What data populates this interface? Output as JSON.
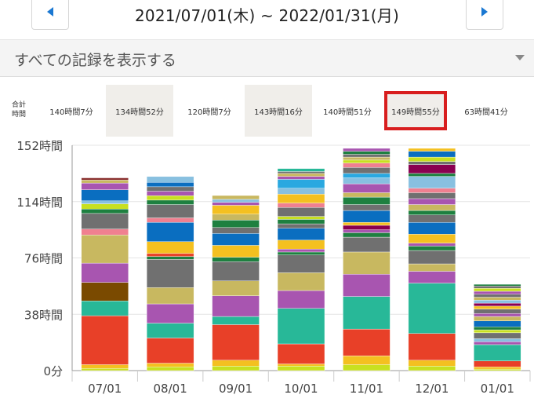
{
  "header": {
    "date_range": "2021/07/01(木) ~ 2022/01/31(月)"
  },
  "filter": {
    "label": "すべての記録を表示する"
  },
  "summary": {
    "label_line1": "合計",
    "label_line2": "時間",
    "months": [
      {
        "total": "140時間7分",
        "shaded": false,
        "selected": false
      },
      {
        "total": "134時間52分",
        "shaded": true,
        "selected": false
      },
      {
        "total": "120時間7分",
        "shaded": false,
        "selected": false
      },
      {
        "total": "143時間16分",
        "shaded": true,
        "selected": false
      },
      {
        "total": "140時間51分",
        "shaded": false,
        "selected": false
      },
      {
        "total": "149時間55分",
        "shaded": true,
        "selected": true
      },
      {
        "total": "63時間41分",
        "shaded": false,
        "selected": false
      }
    ]
  },
  "chart_data": {
    "type": "bar",
    "stacked": true,
    "categories": [
      "07/01",
      "08/01",
      "09/01",
      "10/01",
      "11/01",
      "12/01",
      "01/01"
    ],
    "y_ticks": [
      "0分",
      "38時間",
      "76時間",
      "114時間",
      "152時間"
    ],
    "y_tick_values": [
      0,
      38,
      76,
      114,
      152
    ],
    "ylim": [
      0,
      152
    ],
    "totals_hours": [
      140.1,
      134.9,
      120.1,
      143.3,
      140.9,
      149.9,
      63.7
    ],
    "stacks": [
      [
        [
          1.5,
          "#c8e020"
        ],
        [
          2.5,
          "#f4c020"
        ],
        [
          33,
          "#e84028"
        ],
        [
          10,
          "#28b898"
        ],
        [
          12.5,
          "#7a4a00"
        ],
        [
          13,
          "#a855b0"
        ],
        [
          19,
          "#c8b860"
        ],
        [
          4,
          "#f08090"
        ],
        [
          10.5,
          "#707070"
        ],
        [
          3,
          "#1e8040"
        ],
        [
          3.5,
          "#c8e020"
        ],
        [
          2,
          "#88c0e0"
        ],
        [
          7.5,
          "#0a6ec0"
        ],
        [
          4.5,
          "#a855b0"
        ],
        [
          2,
          "#c8b860"
        ],
        [
          1.5,
          "#8a3030"
        ]
      ],
      [
        [
          2.5,
          "#c8e020"
        ],
        [
          2.5,
          "#f4c020"
        ],
        [
          17,
          "#e84028"
        ],
        [
          10,
          "#28b898"
        ],
        [
          13,
          "#a855b0"
        ],
        [
          11,
          "#c8b860"
        ],
        [
          19,
          "#707070"
        ],
        [
          2,
          "#1e8040"
        ],
        [
          2,
          "#e84028"
        ],
        [
          8,
          "#f4c020"
        ],
        [
          13,
          "#0a6ec0"
        ],
        [
          3,
          "#f08090"
        ],
        [
          9,
          "#707070"
        ],
        [
          3,
          "#1e8040"
        ],
        [
          3,
          "#c8e020"
        ],
        [
          3,
          "#a855b0"
        ],
        [
          3,
          "#707070"
        ],
        [
          3,
          "#0a6ec0"
        ],
        [
          3.9,
          "#88c0e0"
        ]
      ],
      [
        [
          3,
          "#c8e020"
        ],
        [
          4,
          "#f4c020"
        ],
        [
          24,
          "#e84028"
        ],
        [
          5.5,
          "#28b898"
        ],
        [
          14,
          "#a855b0"
        ],
        [
          10,
          "#c8b860"
        ],
        [
          13,
          "#707070"
        ],
        [
          3,
          "#1e8040"
        ],
        [
          8,
          "#f4c020"
        ],
        [
          8,
          "#0a6ec0"
        ],
        [
          4,
          "#707070"
        ],
        [
          5,
          "#1e8040"
        ],
        [
          4,
          "#c8b860"
        ],
        [
          6,
          "#f4c020"
        ],
        [
          2,
          "#a855b0"
        ],
        [
          2,
          "#88c0e0"
        ],
        [
          2.6,
          "#c8b860"
        ]
      ],
      [
        [
          3,
          "#c8e020"
        ],
        [
          1.5,
          "#f4c020"
        ],
        [
          13.5,
          "#e84028"
        ],
        [
          24,
          "#28b898"
        ],
        [
          12,
          "#a855b0"
        ],
        [
          12,
          "#c8b860"
        ],
        [
          12,
          "#707070"
        ],
        [
          2,
          "#1e8040"
        ],
        [
          2,
          "#a855b0"
        ],
        [
          6,
          "#f4c020"
        ],
        [
          8,
          "#0a6ec0"
        ],
        [
          3,
          "#707070"
        ],
        [
          3,
          "#1e8040"
        ],
        [
          2,
          "#c8e020"
        ],
        [
          6,
          "#707070"
        ],
        [
          3,
          "#f08090"
        ],
        [
          6,
          "#f4c020"
        ],
        [
          4,
          "#88c0e0"
        ],
        [
          6,
          "#2aa8e0"
        ],
        [
          2,
          "#a855b0"
        ],
        [
          2,
          "#c8b860"
        ],
        [
          1.3,
          "#707070"
        ],
        [
          2,
          "#28b898"
        ]
      ],
      [
        [
          4,
          "#c8e020"
        ],
        [
          6,
          "#f4c020"
        ],
        [
          18,
          "#e84028"
        ],
        [
          22,
          "#28b898"
        ],
        [
          15,
          "#a855b0"
        ],
        [
          15,
          "#c8b860"
        ],
        [
          10,
          "#707070"
        ],
        [
          3,
          "#1e8040"
        ],
        [
          2,
          "#a855b0"
        ],
        [
          3,
          "#8a0050"
        ],
        [
          2,
          "#f4c020"
        ],
        [
          8,
          "#0a6ec0"
        ],
        [
          4,
          "#707070"
        ],
        [
          5,
          "#1e8040"
        ],
        [
          3,
          "#c8b860"
        ],
        [
          6,
          "#a855b0"
        ],
        [
          4,
          "#88c0e0"
        ],
        [
          3,
          "#2aa8e0"
        ],
        [
          4,
          "#707070"
        ],
        [
          3,
          "#f08090"
        ],
        [
          2,
          "#c8e020"
        ],
        [
          2,
          "#c8b860"
        ],
        [
          1.9,
          "#707070"
        ],
        [
          2,
          "#1e8040"
        ],
        [
          2,
          "#a855b0"
        ]
      ],
      [
        [
          3,
          "#c8e020"
        ],
        [
          4,
          "#f4c020"
        ],
        [
          18,
          "#e84028"
        ],
        [
          34,
          "#28b898"
        ],
        [
          8,
          "#a855b0"
        ],
        [
          5,
          "#c8b860"
        ],
        [
          9,
          "#707070"
        ],
        [
          3,
          "#1e8040"
        ],
        [
          2,
          "#a855b0"
        ],
        [
          6,
          "#f4c020"
        ],
        [
          8,
          "#0a6ec0"
        ],
        [
          5,
          "#707070"
        ],
        [
          3,
          "#1e8040"
        ],
        [
          4,
          "#c8b860"
        ],
        [
          4,
          "#a855b0"
        ],
        [
          4,
          "#707070"
        ],
        [
          3,
          "#f08090"
        ],
        [
          8,
          "#88c0e0"
        ],
        [
          2,
          "#1e8040"
        ],
        [
          6,
          "#8a0050"
        ],
        [
          2,
          "#707070"
        ],
        [
          3,
          "#c8e020"
        ],
        [
          4,
          "#0a6ec0"
        ],
        [
          1.9,
          "#f4c020"
        ]
      ],
      [
        [
          1,
          "#c8e020"
        ],
        [
          1.5,
          "#f4c020"
        ],
        [
          4,
          "#e84028"
        ],
        [
          11,
          "#28b898"
        ],
        [
          2,
          "#a855b0"
        ],
        [
          2,
          "#88c0e0"
        ],
        [
          4,
          "#707070"
        ],
        [
          2,
          "#c8e020"
        ],
        [
          2,
          "#1e8040"
        ],
        [
          4,
          "#0a6ec0"
        ],
        [
          3,
          "#c8b860"
        ],
        [
          2,
          "#a855b0"
        ],
        [
          3,
          "#707070"
        ],
        [
          2,
          "#f4c020"
        ],
        [
          2,
          "#8a0050"
        ],
        [
          2,
          "#88c0e0"
        ],
        [
          2,
          "#c8b860"
        ],
        [
          2,
          "#707070"
        ],
        [
          2,
          "#a855b0"
        ],
        [
          2,
          "#c8e020"
        ],
        [
          1.6,
          "#707070"
        ],
        [
          1.1,
          "#1e8040"
        ]
      ]
    ]
  }
}
